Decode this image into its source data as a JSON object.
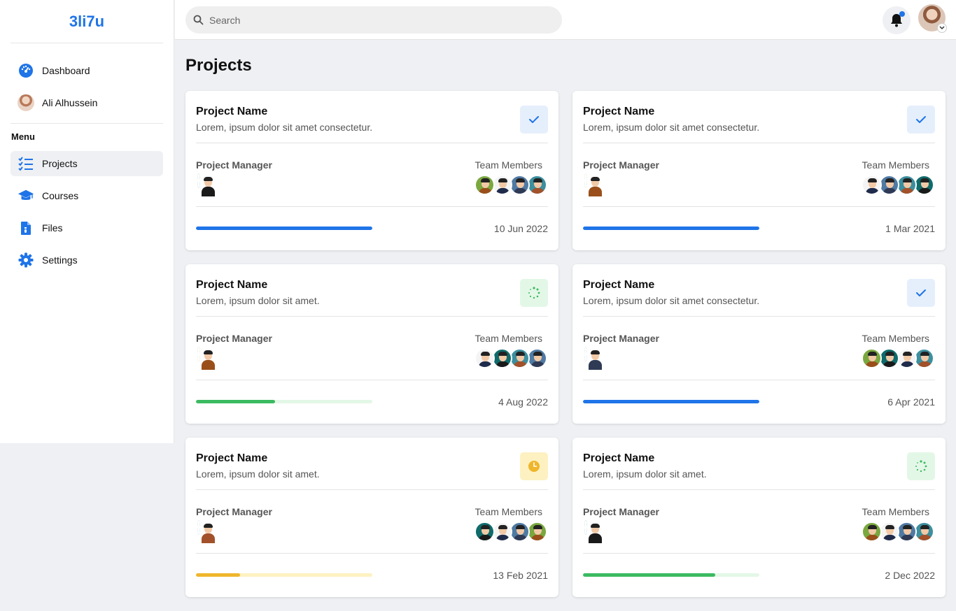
{
  "app": {
    "logo": "3li7u"
  },
  "search": {
    "placeholder": "Search"
  },
  "sidebar": {
    "top": [
      {
        "label": "Dashboard",
        "icon": "dashboard-gauge-icon"
      },
      {
        "label": "Ali Alhussein",
        "icon": "avatar"
      }
    ],
    "menu_label": "Menu",
    "items": [
      {
        "label": "Projects",
        "icon": "list-check-icon",
        "active": true
      },
      {
        "label": "Courses",
        "icon": "graduation-cap-icon",
        "active": false
      },
      {
        "label": "Files",
        "icon": "file-icon",
        "active": false
      },
      {
        "label": "Settings",
        "icon": "gear-icon",
        "active": false
      }
    ]
  },
  "page": {
    "title": "Projects"
  },
  "labels": {
    "project_manager": "Project Manager",
    "team_members": "Team Members"
  },
  "colors": {
    "accent": "#1f74e8",
    "done": "#1f74e8",
    "progress": "#3cba61",
    "pending": "#efb62c"
  },
  "projects": [
    {
      "name": "Project Name",
      "description": "Lorem, ipsum dolor sit amet consectetur.",
      "status": "done",
      "progress": 1.0,
      "date": "10 Jun 2022"
    },
    {
      "name": "Project Name",
      "description": "Lorem, ipsum dolor sit amet consectetur.",
      "status": "done",
      "progress": 1.0,
      "date": "1 Mar 2021"
    },
    {
      "name": "Project Name",
      "description": "Lorem, ipsum dolor sit amet.",
      "status": "in-progress",
      "progress": 0.45,
      "date": "4 Aug 2022"
    },
    {
      "name": "Project Name",
      "description": "Lorem, ipsum dolor sit amet consectetur.",
      "status": "done",
      "progress": 1.0,
      "date": "6 Apr 2021"
    },
    {
      "name": "Project Name",
      "description": "Lorem, ipsum dolor sit amet.",
      "status": "pending",
      "progress": 0.25,
      "date": "13 Feb 2021"
    },
    {
      "name": "Project Name",
      "description": "Lorem, ipsum dolor sit amet.",
      "status": "in-progress",
      "progress": 0.75,
      "date": "2 Dec 2022"
    }
  ]
}
